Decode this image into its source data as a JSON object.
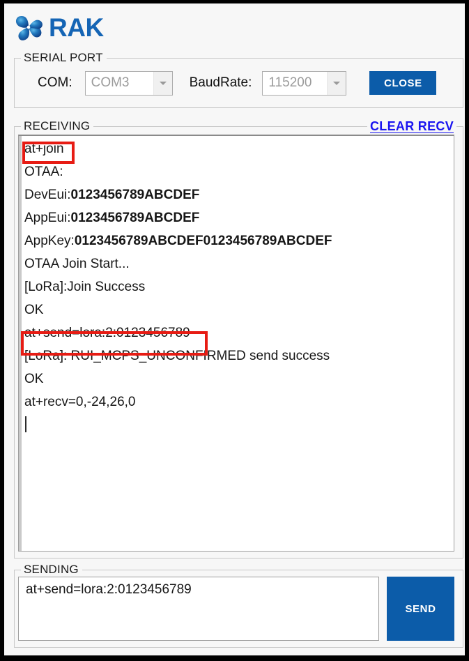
{
  "app": {
    "brand": "RAK",
    "logo_icon": "rak-pinwheel-logo",
    "brand_color": "#1565b5",
    "accent_color": "#0c5ca9",
    "link_color": "#1a14f0",
    "highlight_color": "#e71c14"
  },
  "serial_port": {
    "legend": "SERIAL PORT",
    "com_label": "COM:",
    "com_value": "COM3",
    "baud_label": "BaudRate:",
    "baud_value": "115200",
    "connect_button": "CLOSE",
    "dropdown_icon": "chevron-down-icon"
  },
  "receiving": {
    "legend": "RECEIVING",
    "clear_link": "CLEAR RECV",
    "lines": [
      {
        "type": "plain",
        "text": "at+join",
        "highlighted": true
      },
      {
        "type": "plain",
        "text": "OTAA:",
        "highlighted": false
      },
      {
        "type": "kv",
        "label": "DevEui:",
        "value": "0123456789ABCDEF",
        "highlighted": false
      },
      {
        "type": "kv",
        "label": "AppEui:",
        "value": "0123456789ABCDEF",
        "highlighted": false
      },
      {
        "type": "kv",
        "label": "AppKey:",
        "value": "0123456789ABCDEF0123456789ABCDEF",
        "highlighted": false
      },
      {
        "type": "plain",
        "text": "OTAA Join Start...",
        "highlighted": false
      },
      {
        "type": "plain",
        "text": "[LoRa]:Join Success",
        "highlighted": false
      },
      {
        "type": "plain",
        "text": "OK",
        "highlighted": false
      },
      {
        "type": "plain",
        "text": "at+send=lora:2:0123456789",
        "highlighted": true
      },
      {
        "type": "plain",
        "text": "[LoRa]: RUI_MCPS_UNCONFIRMED send success",
        "highlighted": false
      },
      {
        "type": "plain",
        "text": "OK",
        "highlighted": false
      },
      {
        "type": "plain",
        "text": "at+recv=0,-24,26,0",
        "highlighted": false
      },
      {
        "type": "caret",
        "text": "",
        "highlighted": false
      }
    ]
  },
  "sending": {
    "legend": "SENDING",
    "value": "at+send=lora:2:0123456789",
    "send_button": "SEND"
  }
}
